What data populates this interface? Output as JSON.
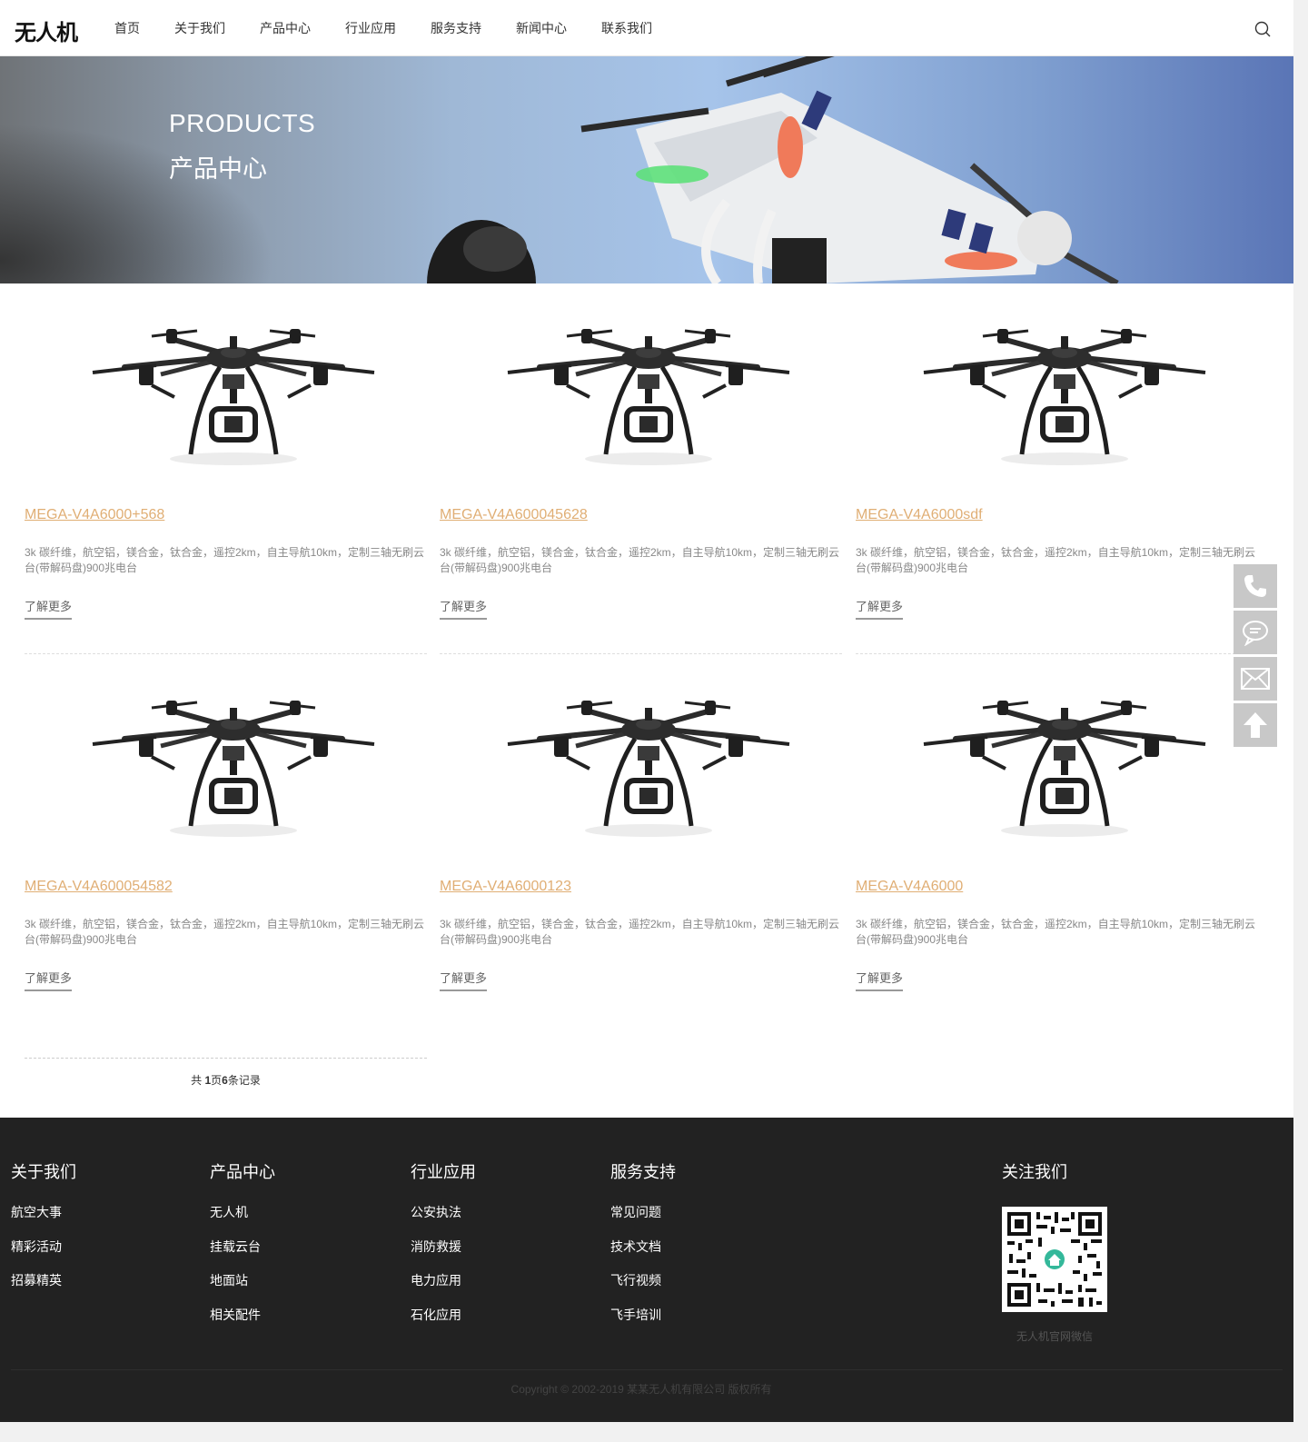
{
  "header": {
    "logo": "无人机",
    "nav": [
      "首页",
      "关于我们",
      "产品中心",
      "行业应用",
      "服务支持",
      "新闻中心",
      "联系我们"
    ]
  },
  "banner": {
    "title_en": "PRODUCTS",
    "title_cn": "产品中心"
  },
  "products": [
    {
      "title": "MEGA-V4A6000+568",
      "desc": "3k 碳纤维，航空铝，镁合金，钛合金，遥控2km，自主导航10km，定制三轴无刷云台(带解码盘)900兆电台",
      "more": "了解更多"
    },
    {
      "title": "MEGA-V4A600045628",
      "desc": "3k 碳纤维，航空铝，镁合金，钛合金，遥控2km，自主导航10km，定制三轴无刷云台(带解码盘)900兆电台",
      "more": "了解更多"
    },
    {
      "title": "MEGA-V4A6000sdf",
      "desc": "3k 碳纤维，航空铝，镁合金，钛合金，遥控2km，自主导航10km，定制三轴无刷云台(带解码盘)900兆电台",
      "more": "了解更多"
    },
    {
      "title": "MEGA-V4A600054582",
      "desc": "3k 碳纤维，航空铝，镁合金，钛合金，遥控2km，自主导航10km，定制三轴无刷云台(带解码盘)900兆电台",
      "more": "了解更多"
    },
    {
      "title": "MEGA-V4A6000123",
      "desc": "3k 碳纤维，航空铝，镁合金，钛合金，遥控2km，自主导航10km，定制三轴无刷云台(带解码盘)900兆电台",
      "more": "了解更多"
    },
    {
      "title": "MEGA-V4A6000",
      "desc": "3k 碳纤维，航空铝，镁合金，钛合金，遥控2km，自主导航10km，定制三轴无刷云台(带解码盘)900兆电台",
      "more": "了解更多"
    }
  ],
  "pager": {
    "prefix": "共 ",
    "pages": "1",
    "mid": "页",
    "count": "6",
    "suffix": "条记录"
  },
  "side_icons": [
    "phone-icon",
    "chat-icon",
    "mail-icon",
    "arrow-up-icon"
  ],
  "footer": {
    "cols": [
      {
        "title": "关于我们",
        "links": [
          "航空大事",
          "精彩活动",
          "招募精英"
        ]
      },
      {
        "title": "产品中心",
        "links": [
          "无人机",
          "挂载云台",
          "地面站",
          "相关配件"
        ]
      },
      {
        "title": "行业应用",
        "links": [
          "公安执法",
          "消防救援",
          "电力应用",
          "石化应用"
        ]
      },
      {
        "title": "服务支持",
        "links": [
          "常见问题",
          "技术文档",
          "飞行视频",
          "飞手培训"
        ]
      }
    ],
    "follow_title": "关注我们",
    "qr_caption": "无人机官网微信",
    "copyright": "Copyright © 2002-2019 某某无人机有限公司 版权所有"
  },
  "colors": {
    "accent": "#e0ae74",
    "footer_bg": "#222222",
    "side_bg": "#c8c8c8"
  }
}
